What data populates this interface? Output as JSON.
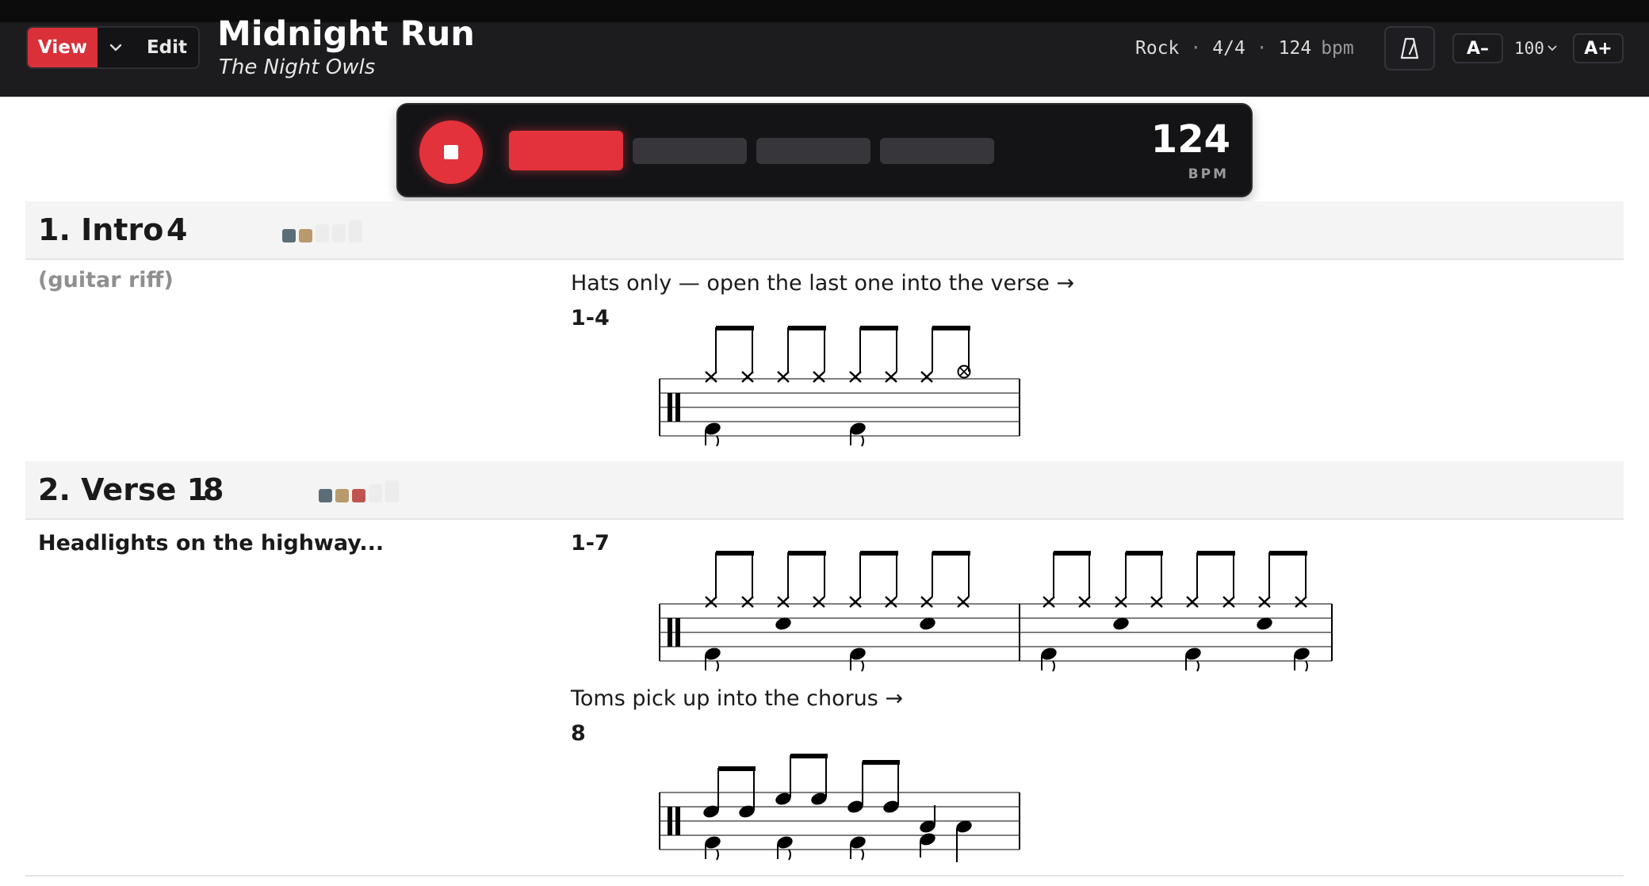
{
  "header": {
    "view_label": "View",
    "edit_label": "Edit",
    "title": "Midnight Run",
    "artist": "The Night Owls",
    "style": "Rock",
    "time_signature": "4/4",
    "tempo": "124",
    "tempo_unit": "bpm",
    "zoom_out_label": "A–",
    "zoom_value": "100",
    "zoom_in_label": "A+",
    "separator": "·"
  },
  "player": {
    "bpm": "124",
    "bpm_label": "BPM",
    "active_beat": 1,
    "beat_count": 4
  },
  "sections": [
    {
      "name": "1. Intro",
      "bars": "4",
      "lyric": "(guitar riff)",
      "swatches": [
        "#5b6e78",
        "#b89a6c"
      ],
      "empty_swatches": 3,
      "notation": [
        {
          "note": "Hats only — open the last one into the verse →",
          "label": "1-4"
        }
      ]
    },
    {
      "name": "2. Verse 1",
      "bars": "8",
      "lyric": "Headlights on the highway...",
      "swatches": [
        "#5b6e78",
        "#b89a6c",
        "#c0554f"
      ],
      "empty_swatches": 2,
      "notation": [
        {
          "note": "",
          "label": "1-7"
        },
        {
          "note": "Toms pick up into the chorus →",
          "label": "8"
        }
      ]
    }
  ],
  "colors": {
    "accent": "#e3323c",
    "header_bg": "#1c1c1e",
    "section_bg": "#f4f4f4"
  },
  "icons": {
    "mode_menu": "chevron-down-icon",
    "metronome": "metronome-icon",
    "zoom_menu": "chevron-down-icon",
    "stop": "stop-icon"
  }
}
